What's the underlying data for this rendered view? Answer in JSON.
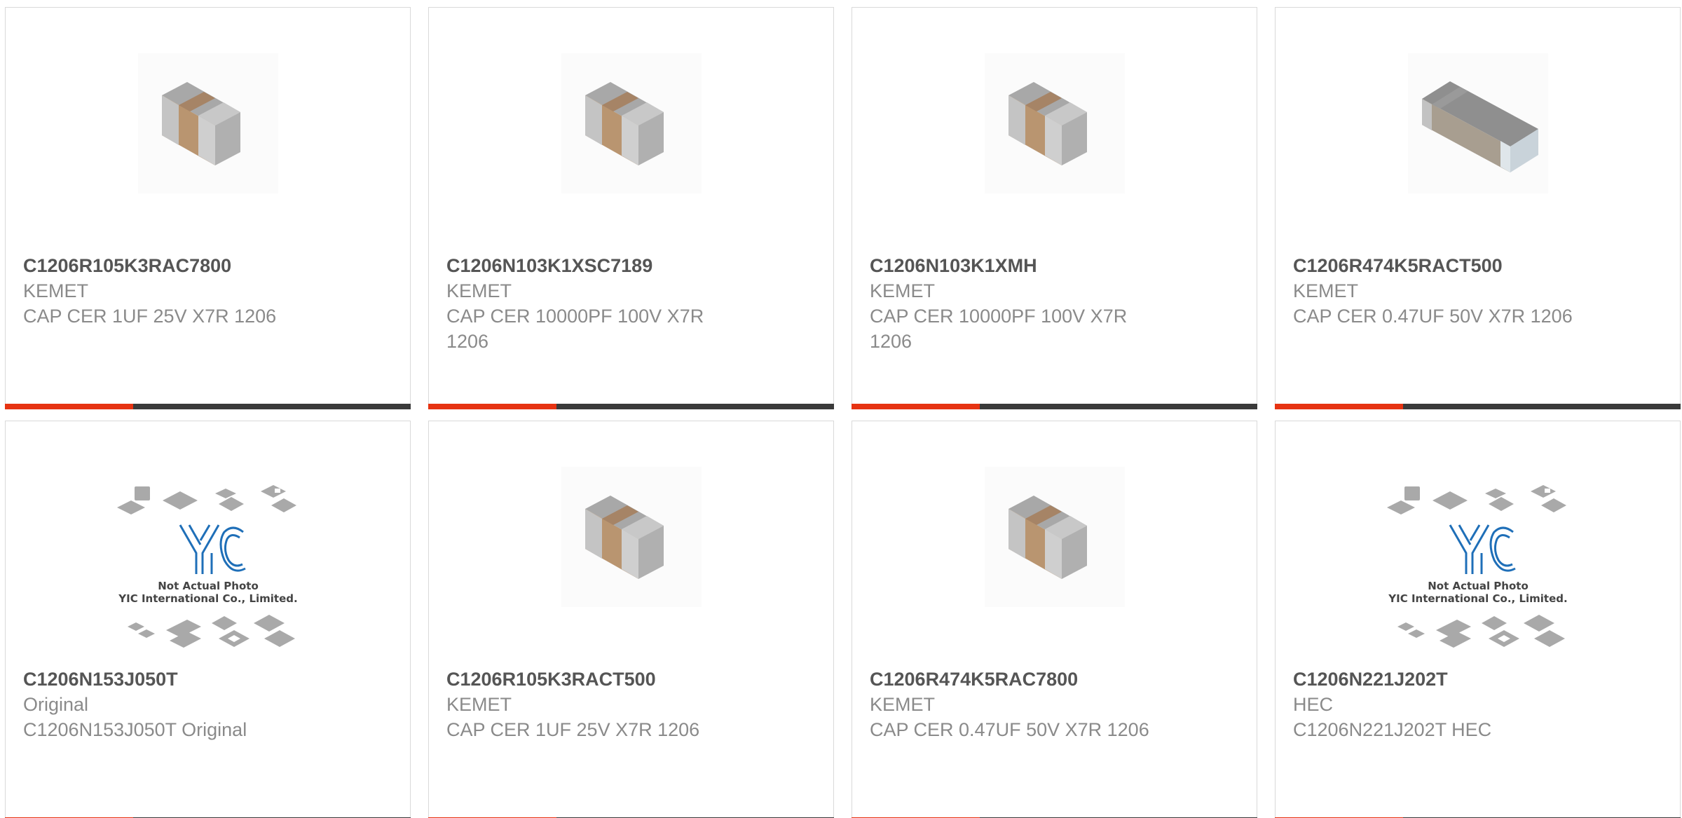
{
  "colors": {
    "accent": "#e63312",
    "bar": "#3a3a3a",
    "part_number": "#555555",
    "secondary_text": "#8a8a8a",
    "border": "#d9d9d9"
  },
  "products": [
    {
      "part_number": "C1206R105K3RAC7800",
      "manufacturer": "KEMET",
      "description": "CAP CER 1UF 25V X7R 1206",
      "image": "capacitor-chip-icon"
    },
    {
      "part_number": "C1206N103K1XSC7189",
      "manufacturer": "KEMET",
      "description": "CAP CER 10000PF 100V X7R 1206",
      "image": "capacitor-chip-icon"
    },
    {
      "part_number": "C1206N103K1XMH",
      "manufacturer": "KEMET",
      "description": "CAP CER 10000PF 100V X7R 1206",
      "image": "capacitor-chip-icon"
    },
    {
      "part_number": "C1206R474K5RACT500",
      "manufacturer": "KEMET",
      "description": "CAP CER 0.47UF 50V X7R 1206",
      "image": "capacitor-chip-grey-icon"
    },
    {
      "part_number": "C1206N153J050T",
      "manufacturer": "Original",
      "description": "C1206N153J050T Original",
      "image": "yic-placeholder",
      "placeholder_text": [
        "Not Actual Photo",
        "YIC International Co., Limited."
      ]
    },
    {
      "part_number": "C1206R105K3RACT500",
      "manufacturer": "KEMET",
      "description": "CAP CER 1UF 25V X7R 1206",
      "image": "capacitor-chip-icon"
    },
    {
      "part_number": "C1206R474K5RAC7800",
      "manufacturer": "KEMET",
      "description": "CAP CER 0.47UF 50V X7R 1206",
      "image": "capacitor-chip-icon"
    },
    {
      "part_number": "C1206N221J202T",
      "manufacturer": "HEC",
      "description": "C1206N221J202T HEC",
      "image": "yic-placeholder",
      "placeholder_text": [
        "Not Actual Photo",
        "YIC International Co., Limited."
      ]
    }
  ]
}
